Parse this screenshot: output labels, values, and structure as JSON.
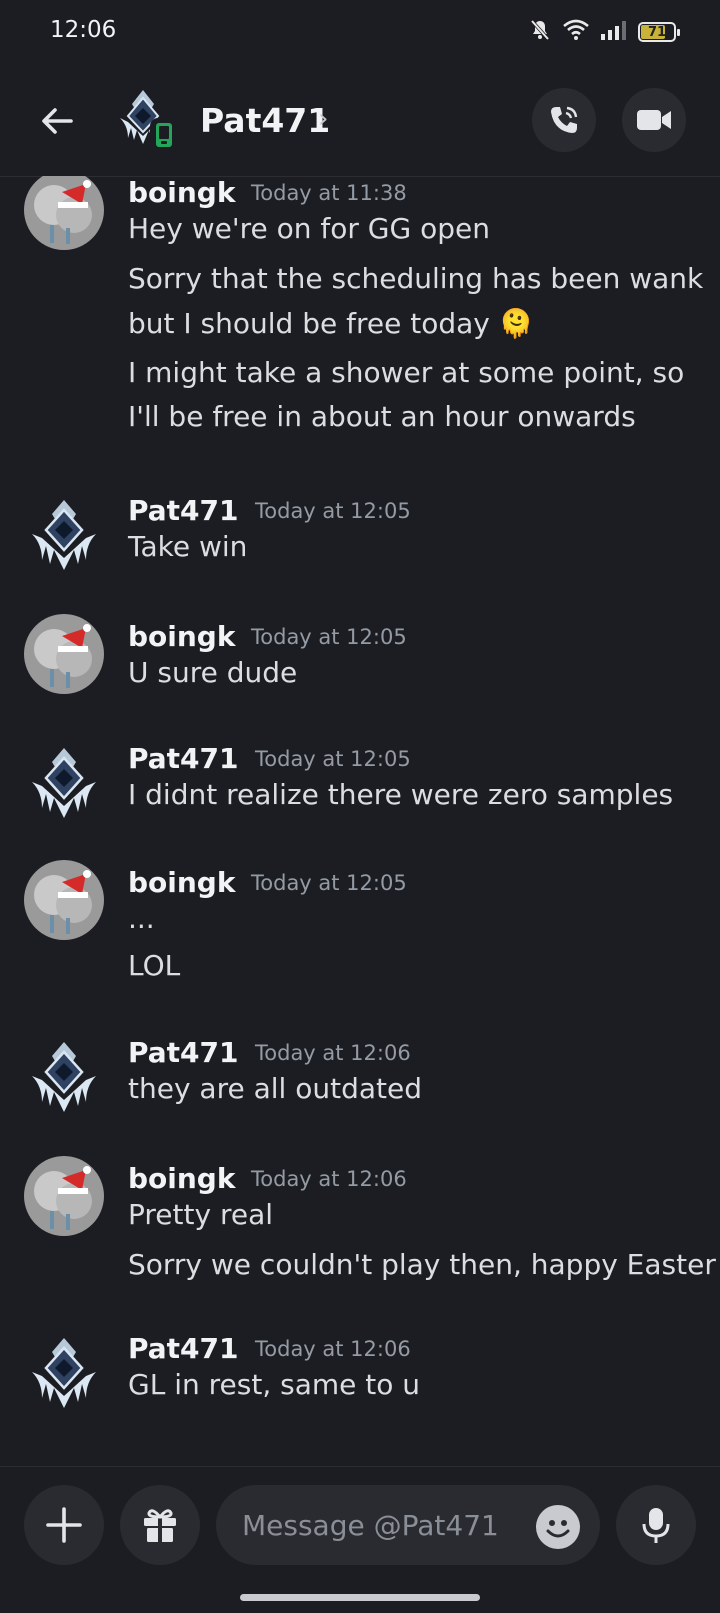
{
  "status_bar": {
    "time": "12:06",
    "battery": "71",
    "icons": [
      "bell-off-icon",
      "wifi-icon",
      "signal-icon",
      "battery-icon"
    ]
  },
  "header": {
    "title": "Pat471",
    "chevron": "›",
    "icons": [
      "back-arrow-icon",
      "phone-call-icon",
      "video-camera-icon",
      "mobile-status-icon"
    ]
  },
  "messages": [
    {
      "author": "boingk",
      "time": "Today at 11:38",
      "lines": [
        "Hey we're on for GG open",
        "Sorry that the scheduling has been wank",
        "but I should be free today 🫠",
        "I might take a shower at some point, so",
        "I'll be free in about an hour onwards"
      ]
    },
    {
      "author": "Pat471",
      "time": "Today at 12:05",
      "lines": [
        "Take win"
      ]
    },
    {
      "author": "boingk",
      "time": "Today at 12:05",
      "lines": [
        "U sure dude"
      ]
    },
    {
      "author": "Pat471",
      "time": "Today at 12:05",
      "lines": [
        "I didnt realize there were zero samples"
      ]
    },
    {
      "author": "boingk",
      "time": "Today at 12:05",
      "lines": [
        "...",
        "LOL"
      ]
    },
    {
      "author": "Pat471",
      "time": "Today at 12:06",
      "lines": [
        "they are all outdated"
      ]
    },
    {
      "author": "boingk",
      "time": "Today at 12:06",
      "lines": [
        "Pretty real",
        "Sorry we couldn't play then, happy Easter"
      ]
    },
    {
      "author": "Pat471",
      "time": "Today at 12:06",
      "lines": [
        "GL in rest, same to u"
      ]
    }
  ],
  "composer": {
    "placeholder": "Message @Pat471",
    "icons": [
      "plus-icon",
      "gift-icon",
      "emoji-icon",
      "microphone-icon"
    ]
  },
  "colors": {
    "background": "#1c1d22",
    "surface": "#2a2b31",
    "online_green": "#23a55a",
    "timestamp": "#949ba4"
  }
}
